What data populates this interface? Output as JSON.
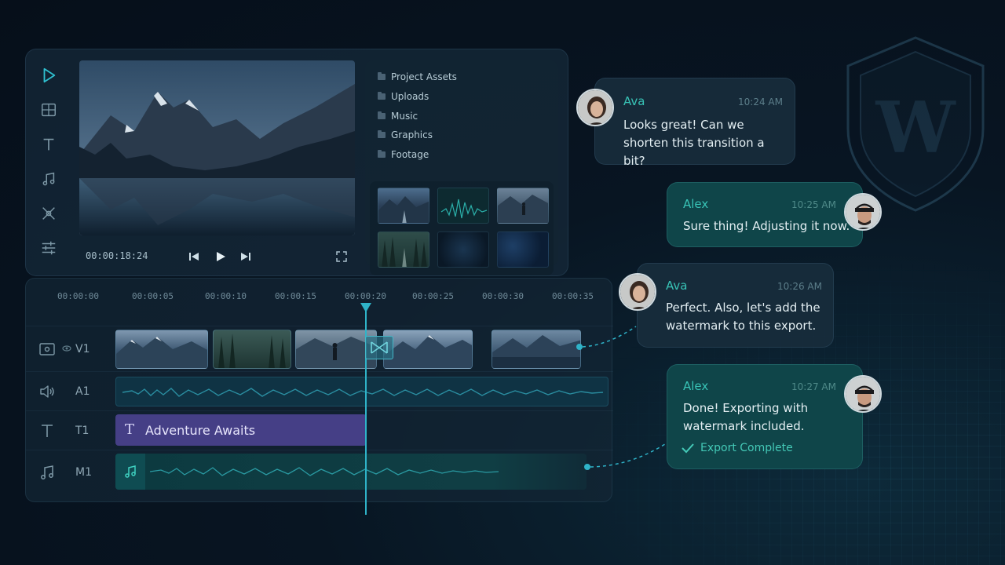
{
  "editor": {
    "toolbar": [
      {
        "icon": "play-icon"
      },
      {
        "icon": "media-grid-icon"
      },
      {
        "icon": "text-icon"
      },
      {
        "icon": "music-note-icon"
      },
      {
        "icon": "transitions-icon"
      },
      {
        "icon": "adjustments-icon"
      }
    ],
    "preview": {
      "timecode": "00:00:18:24"
    },
    "assets": {
      "folders": [
        "Project Assets",
        "Uploads",
        "Music",
        "Graphics",
        "Footage"
      ]
    }
  },
  "timeline": {
    "ruler": [
      "00:00:00",
      "00:00:05",
      "00:00:10",
      "00:00:15",
      "00:00:20",
      "00:00:25",
      "00:00:30",
      "00:00:35"
    ],
    "tracks": [
      {
        "name": "V1"
      },
      {
        "name": "A1"
      },
      {
        "name": "T1"
      },
      {
        "name": "M1"
      }
    ],
    "title_clip_label": "Adventure Awaits",
    "title_clip_glyph": "T"
  },
  "chat": [
    {
      "name": "Ava",
      "time": "10:24 AM",
      "text": "Looks great! Can we shorten this transition a bit?"
    },
    {
      "name": "Alex",
      "time": "10:25 AM",
      "text": "Sure thing! Adjusting it now."
    },
    {
      "name": "Ava",
      "time": "10:26 AM",
      "text": "Perfect. Also, let's add the watermark to this export."
    },
    {
      "name": "Alex",
      "time": "10:27 AM",
      "text": "Done! Exporting with watermark included.",
      "status": "Export Complete"
    }
  ],
  "watermark": {
    "letter": "W"
  },
  "colors": {
    "accent": "#38c3b6",
    "playhead": "#2fb3c8",
    "title_clip": "#453f86"
  }
}
